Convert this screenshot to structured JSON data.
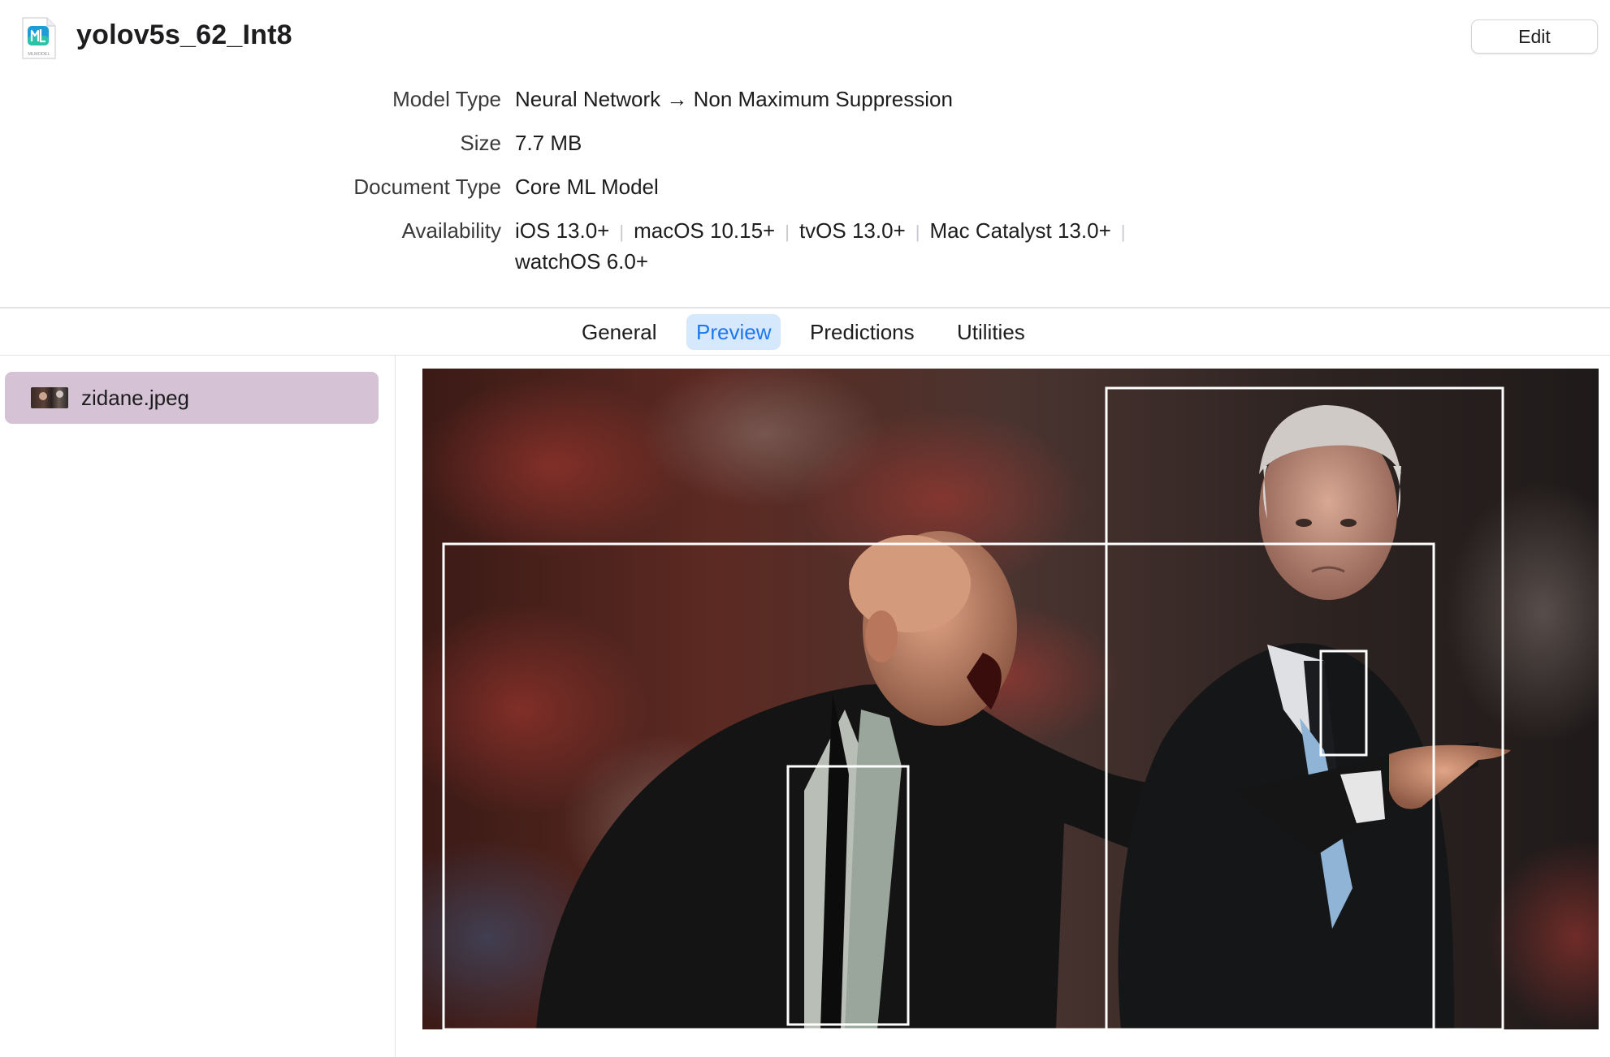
{
  "header": {
    "title": "yolov5s_62_Int8",
    "file_icon_caption": "MLMODEL",
    "edit_label": "Edit"
  },
  "info": {
    "model_type_label": "Model Type",
    "model_type_value": "Neural Network → Non Maximum Suppression",
    "size_label": "Size",
    "size_value": "7.7 MB",
    "document_type_label": "Document Type",
    "document_type_value": "Core ML Model",
    "availability_label": "Availability",
    "availability": [
      "iOS 13.0+",
      "macOS 10.15+",
      "tvOS 13.0+",
      "Mac Catalyst 13.0+",
      "watchOS 6.0+"
    ]
  },
  "tabs": [
    {
      "label": "General",
      "active": false
    },
    {
      "label": "Preview",
      "active": true
    },
    {
      "label": "Predictions",
      "active": false
    },
    {
      "label": "Utilities",
      "active": false
    }
  ],
  "sidebar": {
    "items": [
      {
        "label": "zidane.jpeg",
        "selected": true
      }
    ]
  },
  "colors": {
    "accent": "#1b78ee",
    "tab_active_bg": "#d6e8fc",
    "sidebar_selected_bg": "#d5c3d5",
    "bbox_stroke": "#ffffff"
  }
}
